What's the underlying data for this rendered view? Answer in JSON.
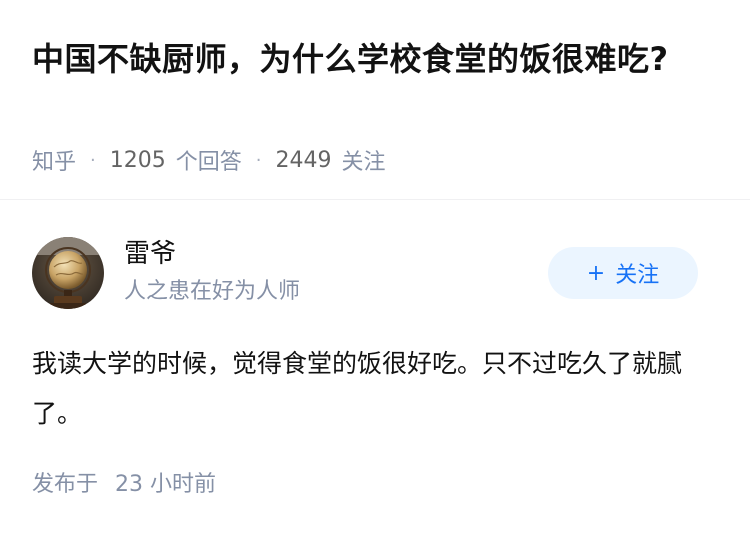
{
  "question": {
    "title": "中国不缺厨师，为什么学校食堂的饭很难吃?",
    "source": "知乎",
    "separator": "·",
    "answer_count": "1205",
    "answer_label": "个回答",
    "follower_count": "2449",
    "follower_label": "关注"
  },
  "answer": {
    "author": {
      "name": "雷爷",
      "headline": "人之患在好为人师",
      "avatar_icon": "globe-avatar"
    },
    "follow_button": {
      "icon": "plus-icon",
      "icon_glyph": "+",
      "label": "关注"
    },
    "content": "我读大学的时候，觉得食堂的饭很好吃。只不过吃久了就腻了。",
    "time_prefix": "发布于",
    "time_value": "23 小时前"
  },
  "colors": {
    "title": "#121212",
    "meta": "#8590a6",
    "accent": "#1772f6",
    "button_bg": "#ebf5ff"
  }
}
